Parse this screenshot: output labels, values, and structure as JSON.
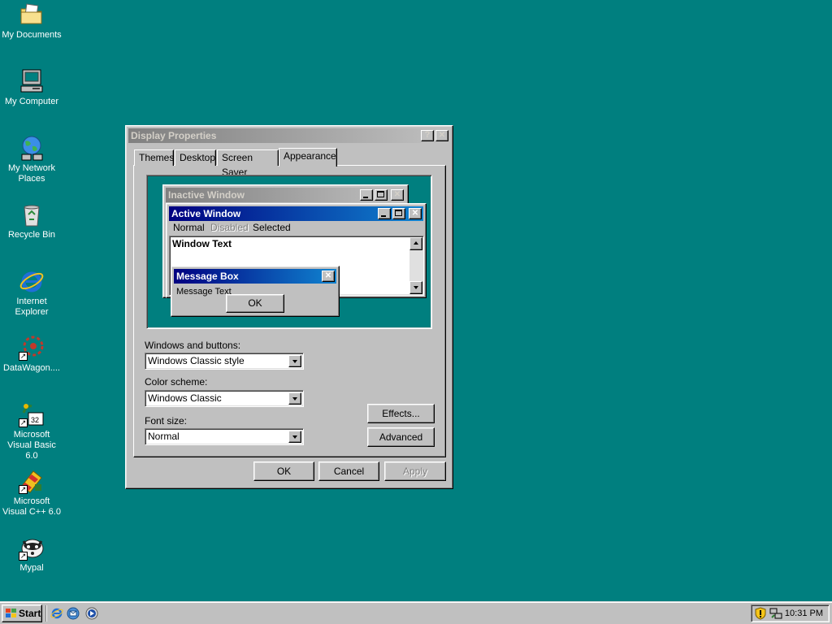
{
  "desktop": {
    "background_color": "#007f7f",
    "icons": [
      {
        "label": "My Documents",
        "icon": "folder-documents-icon"
      },
      {
        "label": "My Computer",
        "icon": "computer-icon"
      },
      {
        "label": "My Network Places",
        "icon": "network-globe-icon"
      },
      {
        "label": "Recycle Bin",
        "icon": "recycle-bin-icon"
      },
      {
        "label": "Internet Explorer",
        "icon": "internet-explorer-icon"
      },
      {
        "label": "DataWagon....",
        "icon": "datawagon-shortcut-icon"
      },
      {
        "label": "Microsoft Visual Basic 6.0",
        "icon": "visual-basic-shortcut-icon"
      },
      {
        "label": "Microsoft Visual C++ 6.0",
        "icon": "visual-cpp-shortcut-icon"
      },
      {
        "label": "Mypal",
        "icon": "mypal-raccoon-icon"
      }
    ]
  },
  "dialog": {
    "title": "Display Properties",
    "help_button": "?",
    "close_button": "✕",
    "tabs": [
      "Themes",
      "Desktop",
      "Screen Saver",
      "Appearance"
    ],
    "active_tab": "Appearance",
    "preview": {
      "inactive_title": "Inactive Window",
      "active_title": "Active Window",
      "menu": {
        "normal": "Normal",
        "disabled": "Disabled",
        "selected": "Selected"
      },
      "window_text": "Window Text",
      "message_box_title": "Message Box",
      "message_text": "Message Text",
      "ok_label": "OK"
    },
    "windows_buttons_label": "Windows and buttons:",
    "windows_buttons_value": "Windows Classic style",
    "color_scheme_label": "Color scheme:",
    "color_scheme_value": "Windows Classic",
    "font_size_label": "Font size:",
    "font_size_value": "Normal",
    "effects_label": "Effects...",
    "advanced_label": "Advanced",
    "ok_label": "OK",
    "cancel_label": "Cancel",
    "apply_label": "Apply"
  },
  "taskbar": {
    "start_label": "Start",
    "quick_launch": [
      "internet-explorer-icon",
      "outlook-express-icon",
      "media-player-icon"
    ],
    "tray_icons": [
      "security-shield-icon",
      "network-tray-icon"
    ],
    "clock": "10:31 PM"
  },
  "colors": {
    "active_title_start": "#000080",
    "active_title_end": "#1084d0",
    "inactive_title_start": "#808080",
    "inactive_title_end": "#c0c0c0",
    "face": "#c0c0c0"
  }
}
